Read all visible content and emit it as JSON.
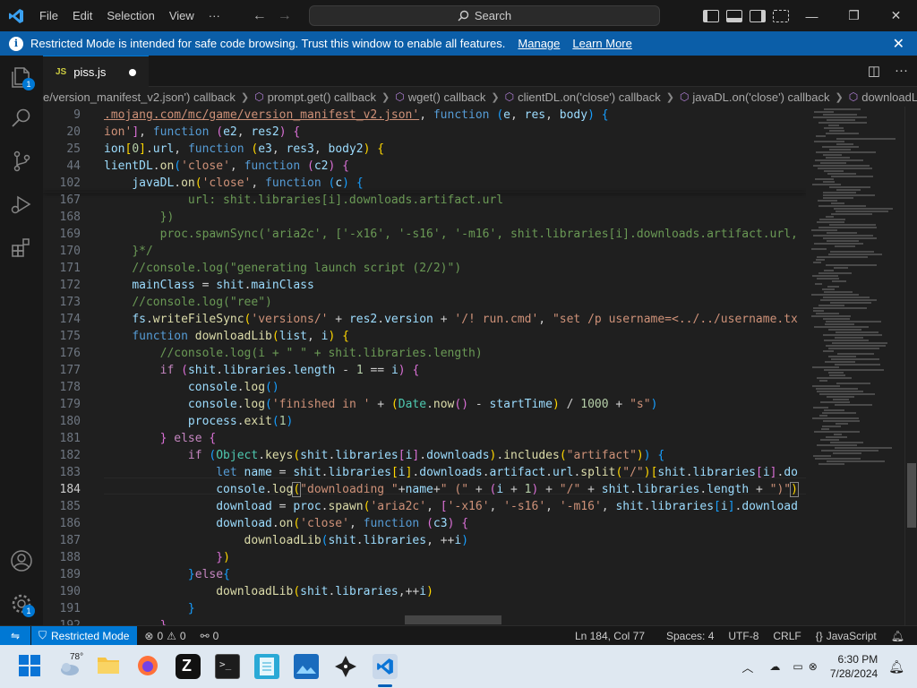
{
  "titlebar": {
    "menu": [
      "File",
      "Edit",
      "Selection",
      "View",
      "···"
    ],
    "search_label": "Search"
  },
  "banner": {
    "message": "Restricted Mode is intended for safe code browsing. Trust this window to enable all features.",
    "manage": "Manage",
    "learn_more": "Learn More"
  },
  "tab": {
    "icon": "JS",
    "title": "piss.js"
  },
  "breadcrumbs": [
    "e/version_manifest_v2.json') callback",
    "prompt.get() callback",
    "wget() callback",
    "clientDL.on('close') callback",
    "javaDL.on('close') callback",
    "downloadLib"
  ],
  "editor": {
    "sticky_line_numbers": [
      "9",
      "20",
      "25",
      "44",
      "102"
    ],
    "line_numbers": [
      "167",
      "168",
      "169",
      "170",
      "171",
      "172",
      "173",
      "174",
      "175",
      "176",
      "177",
      "178",
      "179",
      "180",
      "181",
      "182",
      "183",
      "184",
      "185",
      "186",
      "187",
      "188",
      "189",
      "190",
      "191",
      "192"
    ],
    "active_line": "184"
  },
  "activity_badges": {
    "explorer": "1",
    "manage": "1"
  },
  "statusbar": {
    "restricted": "Restricted Mode",
    "problems_errors": "0",
    "problems_warnings": "0",
    "ports": "0",
    "position": "Ln 184, Col 77",
    "indent": "Spaces: 4",
    "encoding": "UTF-8",
    "eol": "CRLF",
    "language": "JavaScript"
  },
  "taskbar": {
    "weather_temp": "78°",
    "time": "6:30 PM",
    "date": "7/28/2024"
  },
  "colors": {
    "accent": "#0078d4",
    "banner": "#0b5ea8",
    "editor_bg": "#1f1f1f"
  }
}
